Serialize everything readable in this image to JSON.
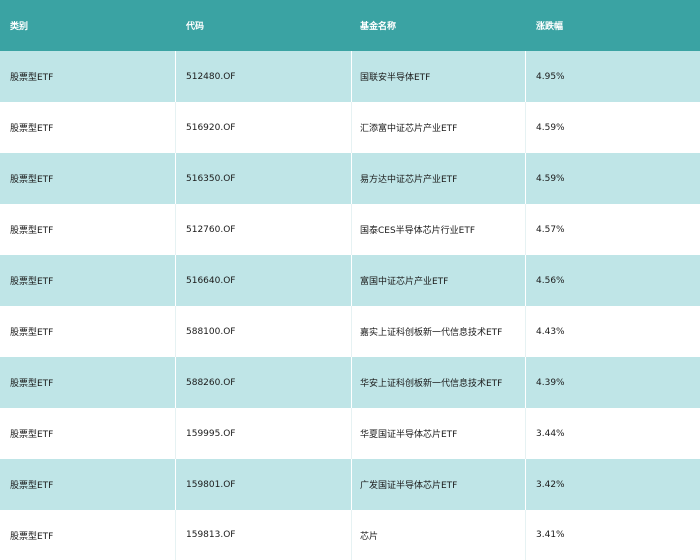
{
  "table": {
    "headers": [
      "类别",
      "代码",
      "基金名称",
      "涨跌幅"
    ],
    "rows": [
      [
        "股票型ETF",
        "512480.OF",
        "国联安半导体ETF",
        "4.95%"
      ],
      [
        "股票型ETF",
        "516920.OF",
        "汇添富中证芯片产业ETF",
        "4.59%"
      ],
      [
        "股票型ETF",
        "516350.OF",
        "易方达中证芯片产业ETF",
        "4.59%"
      ],
      [
        "股票型ETF",
        "512760.OF",
        "国泰CES半导体芯片行业ETF",
        "4.57%"
      ],
      [
        "股票型ETF",
        "516640.OF",
        "富国中证芯片产业ETF",
        "4.56%"
      ],
      [
        "股票型ETF",
        "588100.OF",
        "嘉实上证科创板新一代信息技术ETF",
        "4.43%"
      ],
      [
        "股票型ETF",
        "588260.OF",
        "华安上证科创板新一代信息技术ETF",
        "4.39%"
      ],
      [
        "股票型ETF",
        "159995.OF",
        "华夏国证半导体芯片ETF",
        "3.44%"
      ],
      [
        "股票型ETF",
        "159801.OF",
        "广发国证半导体芯片ETF",
        "3.42%"
      ],
      [
        "股票型ETF",
        "159813.OF",
        "芯片",
        "3.41%"
      ]
    ]
  },
  "colors": {
    "header_bg": "#3aa3a3",
    "header_text": "#ffffff",
    "row_alt_bg": "#bfe5e7",
    "row_plain_bg": "#ffffff"
  }
}
